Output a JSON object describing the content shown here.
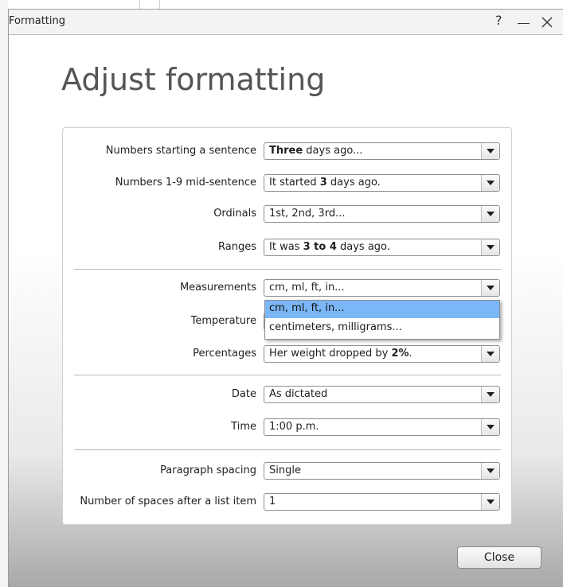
{
  "window": {
    "title": "Formatting",
    "help_label": "?",
    "page_title": "Adjust formatting",
    "close_button": "Close"
  },
  "rows": [
    {
      "label": "Numbers starting a sentence",
      "value_parts": [
        {
          "t": "Three",
          "b": true
        },
        {
          "t": " days ago...",
          "b": false
        }
      ]
    },
    {
      "label": "Numbers 1-9 mid-sentence",
      "value_parts": [
        {
          "t": "It started ",
          "b": false
        },
        {
          "t": "3",
          "b": true
        },
        {
          "t": " days ago.",
          "b": false
        }
      ]
    },
    {
      "label": "Ordinals",
      "value_parts": [
        {
          "t": "1st, 2nd, 3rd...",
          "b": false
        }
      ]
    },
    {
      "label": "Ranges",
      "value_parts": [
        {
          "t": "It was ",
          "b": false
        },
        {
          "t": "3 to 4",
          "b": true
        },
        {
          "t": " days ago.",
          "b": false
        }
      ]
    },
    {
      "label": "Measurements",
      "value_parts": [
        {
          "t": "cm, ml, ft, in...",
          "b": false
        }
      ]
    },
    {
      "label": "Temperature",
      "value_parts": []
    },
    {
      "label": "Percentages",
      "value_parts": [
        {
          "t": "Her weight dropped by ",
          "b": false
        },
        {
          "t": "2%",
          "b": true
        },
        {
          "t": ".",
          "b": false
        }
      ]
    },
    {
      "label": "Date",
      "value_parts": [
        {
          "t": "As dictated",
          "b": false
        }
      ]
    },
    {
      "label": "Time",
      "value_parts": [
        {
          "t": "1:00 p.m.",
          "b": false
        }
      ]
    },
    {
      "label": "Paragraph spacing",
      "value_parts": [
        {
          "t": "Single",
          "b": false
        }
      ]
    },
    {
      "label": "Number of spaces after a list item",
      "value_parts": [
        {
          "t": "1",
          "b": false
        }
      ]
    }
  ],
  "open_dropdown": {
    "options": [
      "cm, ml, ft, in...",
      "centimeters, milligrams..."
    ],
    "selected_index": 0
  },
  "icons": {
    "minimize": "minimize-icon",
    "close": "close-icon",
    "dropdown_arrow": "chevron-down-icon"
  }
}
